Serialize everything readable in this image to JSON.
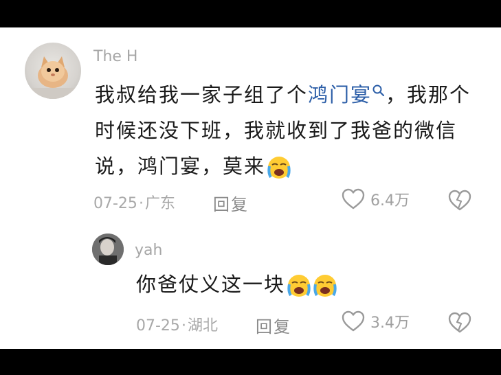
{
  "comment": {
    "username": "The H",
    "text_before": "我叔给我一家子组了个",
    "link_text": "鸿门宴",
    "text_after": "，我那个时候还没下班，我就收到了我爸的微信说，鸿门宴，莫来",
    "emoji": "loudly-crying-face",
    "date": "07-25",
    "location": "广东",
    "reply_label": "回复",
    "likes": "6.4万"
  },
  "reply": {
    "username": "yah",
    "text": "你爸仗义这一块",
    "emoji": "loudly-crying-face",
    "date": "07-25",
    "location": "湖北",
    "reply_label": "回复",
    "likes": "3.4万"
  },
  "colors": {
    "link": "#2d5fa8",
    "meta": "#a8a8a8",
    "text": "#1a1a1a",
    "letterbox": "#000000"
  }
}
